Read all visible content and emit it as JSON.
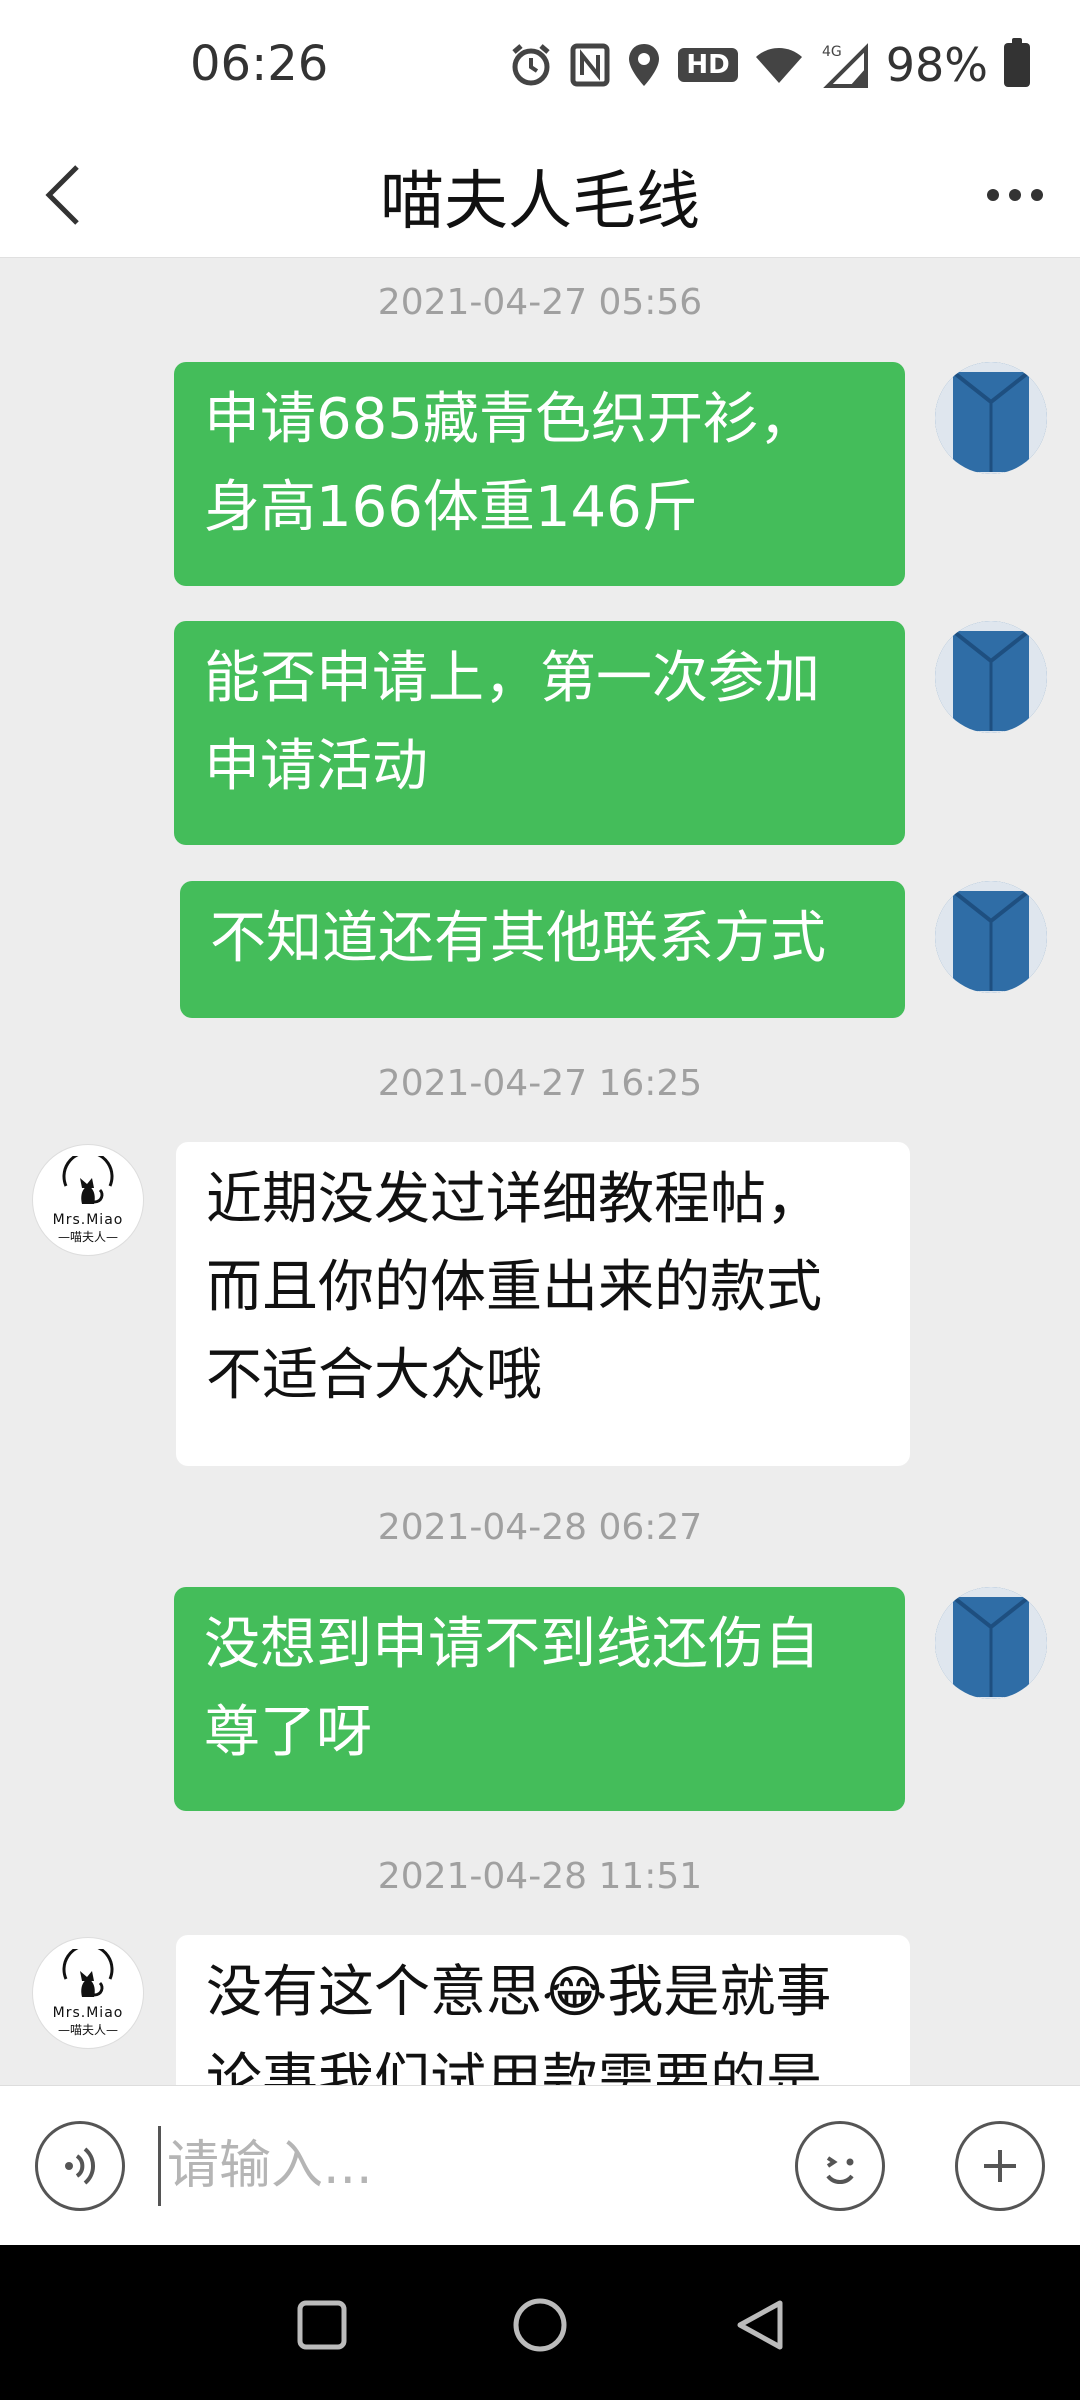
{
  "status_bar": {
    "time": "06:26",
    "battery": "98%",
    "hd": "HD",
    "network": "4G"
  },
  "header": {
    "title": "喵夫人毛线"
  },
  "shop_avatar": {
    "line1": "Mrs.Miao",
    "line2": "—喵夫人—"
  },
  "messages": [
    {
      "type": "timestamp",
      "text": "2021-04-27 05:56"
    },
    {
      "type": "sent",
      "lines": [
        "申请685藏青色织开衫，",
        "身高166体重146斤"
      ]
    },
    {
      "type": "sent",
      "lines": [
        "能否申请上，第一次参加",
        "申请活动"
      ]
    },
    {
      "type": "sent",
      "lines": [
        "不知道还有其他联系方式"
      ]
    },
    {
      "type": "timestamp",
      "text": "2021-04-27 16:25"
    },
    {
      "type": "received",
      "lines": [
        "近期没发过详细教程帖，",
        "而且你的体重出来的款式",
        "不适合大众哦"
      ]
    },
    {
      "type": "timestamp",
      "text": "2021-04-28 06:27"
    },
    {
      "type": "sent",
      "lines": [
        "没想到申请不到线还伤自",
        "尊了呀"
      ]
    },
    {
      "type": "timestamp",
      "text": "2021-04-28 11:51"
    },
    {
      "type": "received",
      "lines": [
        "没有这个意思😂我是就事",
        "论事我们试用款需要的是"
      ]
    }
  ],
  "input_bar": {
    "placeholder": "请输入..."
  },
  "colors": {
    "sent_bubble": "#44bd5a",
    "received_bubble": "#ffffff",
    "background": "#ededed"
  },
  "icons": [
    "back-icon",
    "more-icon",
    "voice-icon",
    "emoji-icon",
    "plus-icon",
    "nav-recent-icon",
    "nav-home-icon",
    "nav-back-icon"
  ]
}
